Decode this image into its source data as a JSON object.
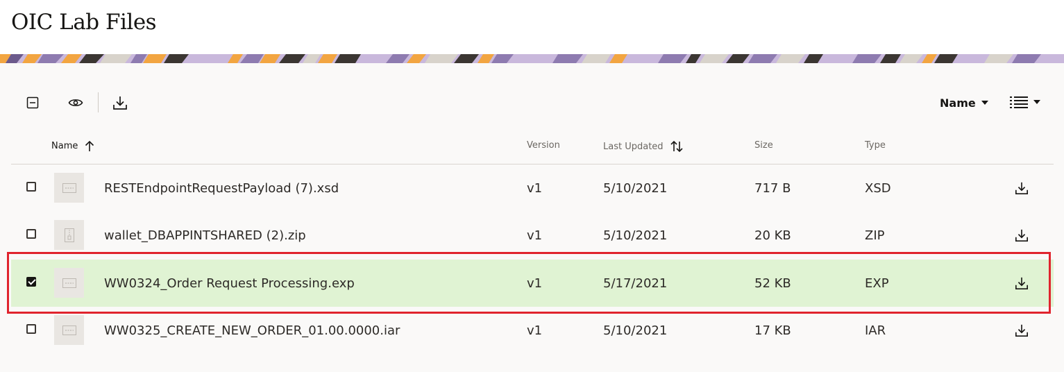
{
  "page": {
    "title": "OIC Lab Files"
  },
  "toolbar": {
    "select_all_icon": "minus-square-icon",
    "preview_icon": "eye-icon",
    "download_icon": "download-icon",
    "sort_label": "Name",
    "view_icon": "list-view-icon"
  },
  "columns": {
    "name": "Name",
    "version": "Version",
    "last_updated": "Last Updated",
    "size": "Size",
    "type": "Type"
  },
  "files": [
    {
      "name": "RESTEndpointRequestPayload (7).xsd",
      "version": "v1",
      "last_updated": "5/10/2021",
      "size": "717 B",
      "type": "XSD",
      "checked": false,
      "icon": "file-icon"
    },
    {
      "name": "wallet_DBAPPINTSHARED (2).zip",
      "version": "v1",
      "last_updated": "5/10/2021",
      "size": "20 KB",
      "type": "ZIP",
      "checked": false,
      "icon": "zip-file-icon"
    },
    {
      "name": "WW0324_Order Request Processing.exp",
      "version": "v1",
      "last_updated": "5/17/2021",
      "size": "52 KB",
      "type": "EXP",
      "checked": true,
      "icon": "file-icon"
    },
    {
      "name": "WW0325_CREATE_NEW_ORDER_01.00.0000.iar",
      "version": "v1",
      "last_updated": "5/10/2021",
      "size": "17 KB",
      "type": "IAR",
      "checked": false,
      "icon": "file-icon"
    }
  ],
  "colors": {
    "selected_row": "#e0f3d3",
    "annotation_box": "#e0242e",
    "panel_background": "#faf9f8"
  }
}
